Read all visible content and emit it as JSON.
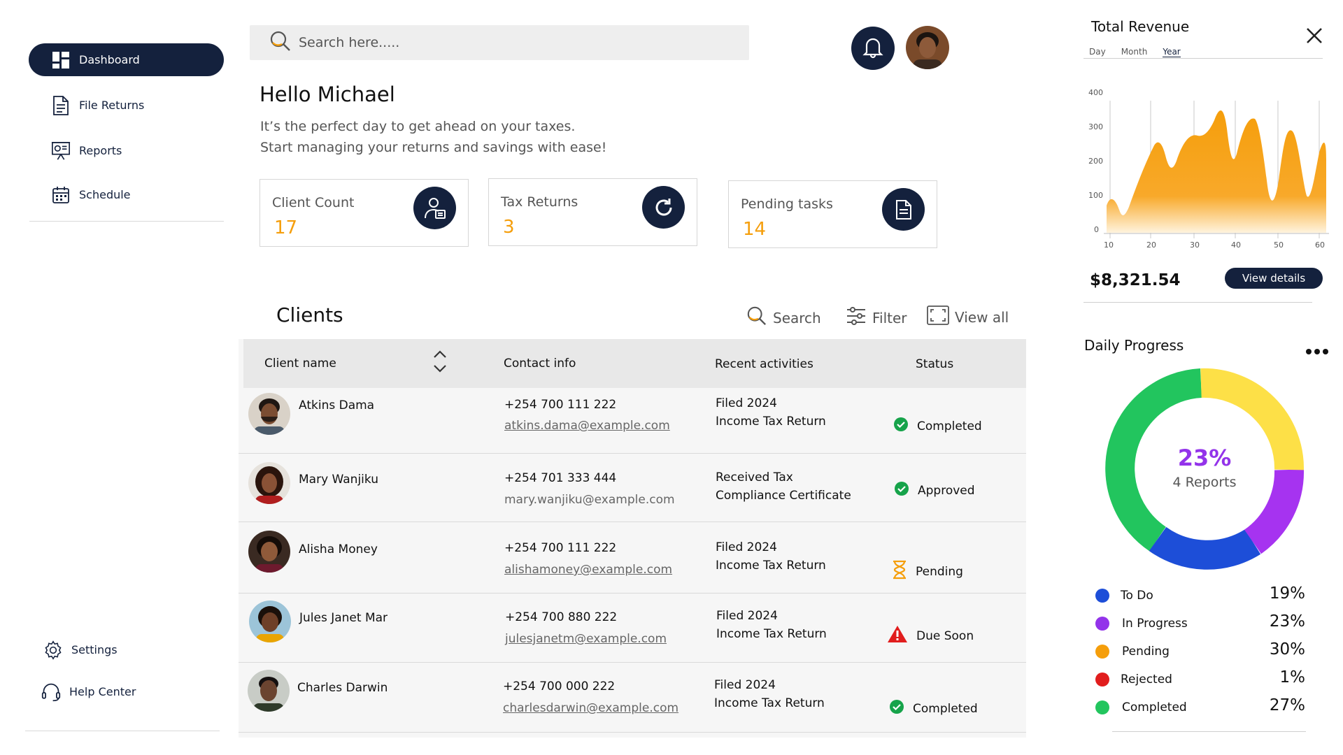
{
  "sidebar": {
    "items": [
      {
        "label": "Dashboard",
        "icon": "dashboard-icon"
      },
      {
        "label": "File Returns",
        "icon": "document-icon"
      },
      {
        "label": "Reports",
        "icon": "presentation-icon"
      },
      {
        "label": "Schedule",
        "icon": "calendar-icon"
      }
    ],
    "bottom": [
      {
        "label": "Settings",
        "icon": "gear-icon"
      },
      {
        "label": "Help Center",
        "icon": "headset-icon"
      }
    ]
  },
  "search": {
    "placeholder": "Search here....."
  },
  "greeting": {
    "title": "Hello Michael",
    "line1": "It’s the perfect day to get ahead on your taxes.",
    "line2": "Start managing your returns and savings with ease!"
  },
  "stats": [
    {
      "label": "Client Count",
      "value": "17"
    },
    {
      "label": "Tax Returns",
      "value": "3"
    },
    {
      "label": "Pending tasks",
      "value": "14"
    }
  ],
  "clients": {
    "title": "Clients",
    "tools": {
      "search": "Search",
      "filter": "Filter",
      "view_all": "View all"
    },
    "columns": [
      "Client name",
      "Contact info",
      "Recent activities",
      "Status"
    ],
    "rows": [
      {
        "name": "Atkins Dama",
        "phone": "+254 700 111 222",
        "email": "atkins.dama@example.com",
        "activity1": "Filed 2024",
        "activity2": "Income Tax Return",
        "status": "Completed",
        "status_type": "ok"
      },
      {
        "name": "Mary Wanjiku",
        "phone": "+254 701 333 444",
        "email": "mary.wanjiku@example.com",
        "activity1": "Received Tax",
        "activity2": "Compliance Certificate",
        "status": "Approved",
        "status_type": "ok"
      },
      {
        "name": "Alisha Money",
        "phone": "+254 700 111 222",
        "email": "alishamoney@example.com",
        "activity1": "Filed 2024",
        "activity2": "Income Tax Return",
        "status": "Pending",
        "status_type": "pending"
      },
      {
        "name": "Jules Janet Mar",
        "phone": "+254 700 880 222",
        "email": "julesjanetm@example.com",
        "activity1": "Filed 2024",
        "activity2": "Income Tax Return",
        "status": "Due Soon",
        "status_type": "warn"
      },
      {
        "name": "Charles Darwin",
        "phone": "+254 700 000 222",
        "email": "charlesdarwin@example.com",
        "activity1": "Filed 2024",
        "activity2": "Income Tax Return",
        "status": "Completed",
        "status_type": "ok"
      }
    ]
  },
  "revenue": {
    "title": "Total Revenue",
    "tabs": [
      "Day",
      "Month",
      "Year"
    ],
    "active_tab": "Year",
    "amount": "$8,321.54",
    "button": "View details",
    "y_ticks": [
      "400",
      "300",
      "200",
      "100",
      "0"
    ],
    "x_ticks": [
      "10",
      "20",
      "30",
      "40",
      "50",
      "60"
    ],
    "color": "#f59e0b"
  },
  "progress": {
    "title": "Daily Progress",
    "center_pct": "23%",
    "center_label": "4 Reports",
    "legend": [
      {
        "name": "To Do",
        "pct": "19%",
        "color": "#1d4ed8"
      },
      {
        "name": "In Progress",
        "pct": "23%",
        "color": "#9333ea"
      },
      {
        "name": "Pending",
        "pct": "30%",
        "color": "#f59e0b"
      },
      {
        "name": "Rejected",
        "pct": "1%",
        "color": "#e11d1d"
      },
      {
        "name": "Completed",
        "pct": "27%",
        "color": "#22c55e"
      }
    ]
  }
}
